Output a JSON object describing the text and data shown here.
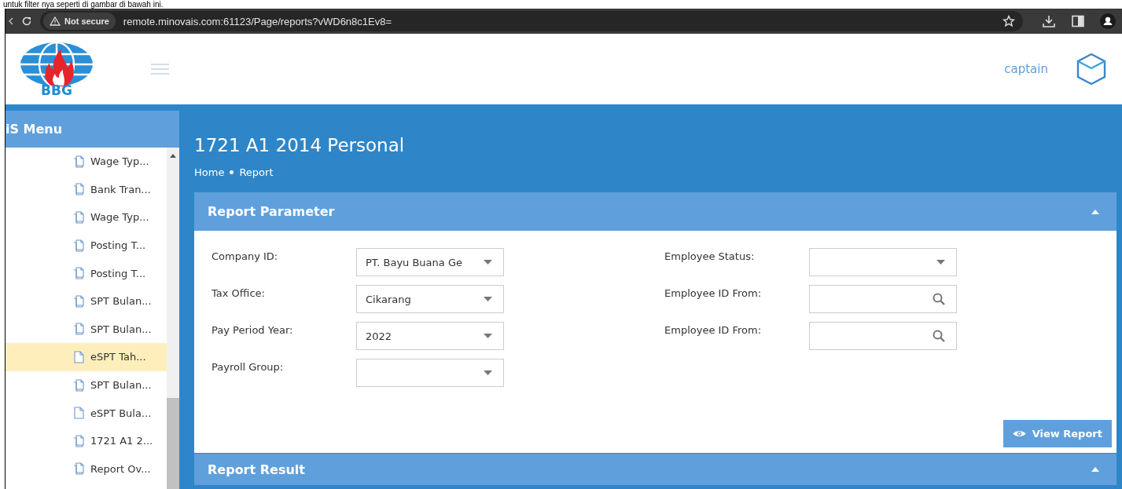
{
  "caption": "untuk filter nya seperti di gambar di bawah ini.",
  "browser": {
    "security": "Not secure",
    "url": "remote.minovais.com:61123/Page/reports?vWD6n8c1Ev8="
  },
  "header": {
    "logo_text": "BBG",
    "user": "captain"
  },
  "sidebar": {
    "title": "iS Menu",
    "items": [
      {
        "label": "Wage Typ...",
        "kind": "report",
        "selected": false
      },
      {
        "label": "Bank Tran...",
        "kind": "report",
        "selected": false
      },
      {
        "label": "Wage Typ...",
        "kind": "report",
        "selected": false
      },
      {
        "label": "Posting T...",
        "kind": "report",
        "selected": false
      },
      {
        "label": "Posting T...",
        "kind": "report",
        "selected": false
      },
      {
        "label": "SPT Bulan...",
        "kind": "report",
        "selected": false
      },
      {
        "label": "SPT Bulan...",
        "kind": "report",
        "selected": false
      },
      {
        "label": "eSPT Tah...",
        "kind": "file",
        "selected": true
      },
      {
        "label": "SPT Bulan...",
        "kind": "report",
        "selected": false
      },
      {
        "label": "eSPT Bula...",
        "kind": "file",
        "selected": false
      },
      {
        "label": "1721 A1 2...",
        "kind": "report",
        "selected": false
      },
      {
        "label": "Report Ov...",
        "kind": "report",
        "selected": false
      }
    ]
  },
  "page": {
    "title": "1721 A1 2014 Personal",
    "breadcrumb": [
      "Home",
      "Report"
    ]
  },
  "report_parameter": {
    "title": "Report Parameter",
    "expanded": true,
    "left_fields": [
      {
        "label": "Company ID:",
        "kind": "select",
        "value": "PT. Bayu Buana Ge"
      },
      {
        "label": "Tax Office:",
        "kind": "select",
        "value": "Cikarang"
      },
      {
        "label": "Pay Period Year:",
        "kind": "select",
        "value": "2022"
      },
      {
        "label": "Payroll Group:",
        "kind": "select"
      }
    ],
    "right_fields": [
      {
        "label": "Employee Status:",
        "kind": "select"
      },
      {
        "label": "Employee ID From:",
        "kind": "lookup"
      },
      {
        "label": "Employee ID From:",
        "kind": "lookup"
      }
    ],
    "button": "View Report"
  },
  "report_result": {
    "title": "Report Result",
    "expanded": true
  }
}
